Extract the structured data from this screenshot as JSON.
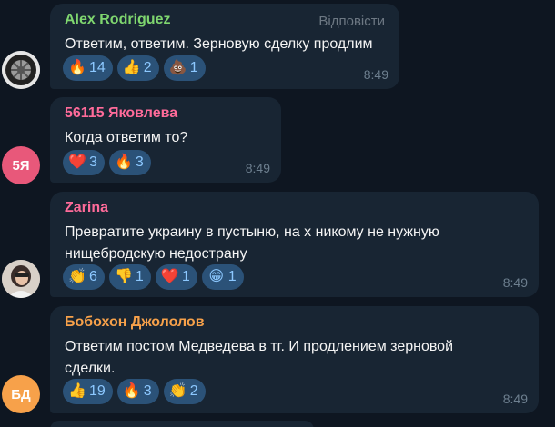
{
  "messages": [
    {
      "author": "Alex Rodriguez",
      "author_color": "#7fd66f",
      "reply_label": "Відповісти",
      "lines": [
        "Ответим, ответим. Зерновую сделку продлим"
      ],
      "reactions": [
        {
          "emoji": "🔥",
          "count": "14"
        },
        {
          "emoji": "👍",
          "count": "2"
        },
        {
          "emoji": "💩",
          "count": "1"
        }
      ],
      "time": "8:49",
      "avatar": {
        "type": "image",
        "icon": "tire-icon"
      }
    },
    {
      "author": "56115 Яковлева",
      "author_color": "#ff6b9a",
      "lines": [
        "Когда ответим то?"
      ],
      "reactions": [
        {
          "emoji": "❤️",
          "count": "3"
        },
        {
          "emoji": "🔥",
          "count": "3"
        }
      ],
      "time": "8:49",
      "avatar": {
        "type": "initials",
        "initials": "5Я",
        "color": "#e8587a"
      }
    },
    {
      "author": "Zarina",
      "author_color": "#ff6b9a",
      "lines": [
        "Превратите украину в пустыню, на х никому не нужную",
        "нищебродскую недострану"
      ],
      "reactions": [
        {
          "emoji": "👏",
          "count": "6"
        },
        {
          "emoji": "👎",
          "count": "1"
        },
        {
          "emoji": "❤️",
          "count": "1"
        },
        {
          "emoji": "😁",
          "count": "1"
        }
      ],
      "time": "8:49",
      "avatar": {
        "type": "image",
        "icon": "girl-photo-icon"
      }
    },
    {
      "author": "Бобохон Джололов",
      "author_color": "#f7a14a",
      "lines": [
        "Ответим постом Медведева в тг. И продлением зерновой",
        "сделки."
      ],
      "reactions": [
        {
          "emoji": "👍",
          "count": "19"
        },
        {
          "emoji": "🔥",
          "count": "3"
        },
        {
          "emoji": "👏",
          "count": "2"
        }
      ],
      "time": "8:49",
      "avatar": {
        "type": "initials",
        "initials": "БД",
        "color": "#f7a14a"
      }
    }
  ]
}
